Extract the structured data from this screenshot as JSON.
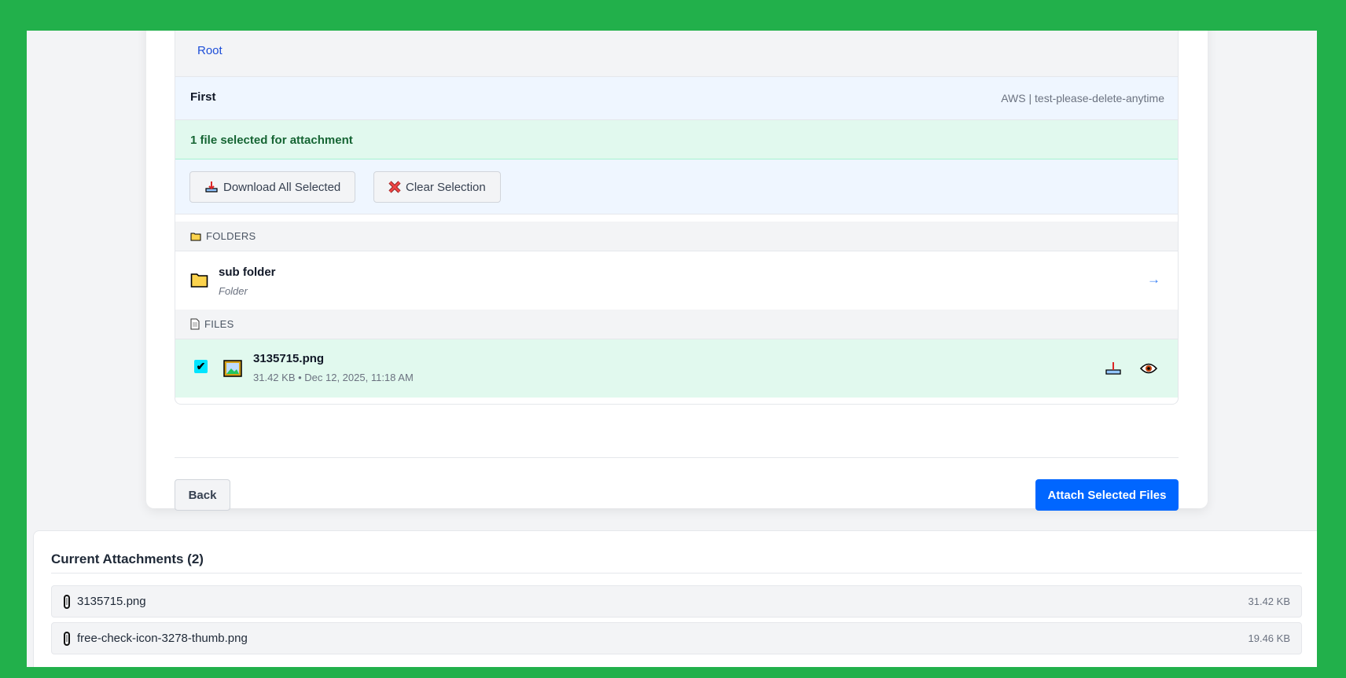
{
  "breadcrumb": {
    "root": "Root"
  },
  "location": {
    "title": "First",
    "source": "AWS | test-please-delete-anytime"
  },
  "selection": {
    "message": "1 file selected for attachment",
    "download_all": "Download All Selected",
    "clear": "Clear Selection"
  },
  "folders": {
    "header": "FOLDERS",
    "items": [
      {
        "name": "sub folder",
        "type": "Folder"
      }
    ]
  },
  "files": {
    "header": "FILES",
    "items": [
      {
        "name": "3135715.png",
        "meta": "31.42 KB • Dec 12, 2025, 11:18 AM",
        "checked": true
      }
    ]
  },
  "actions": {
    "back": "Back",
    "attach": "Attach Selected Files"
  },
  "attachments": {
    "title": "Current Attachments (2)",
    "items": [
      {
        "name": "3135715.png",
        "size": "31.42 KB"
      },
      {
        "name": "free-check-icon-3278-thumb.png",
        "size": "19.46 KB"
      }
    ]
  },
  "colors": {
    "frame": "#22b04b",
    "primary": "#0066ff",
    "selected_bg": "#e1f9ee"
  }
}
